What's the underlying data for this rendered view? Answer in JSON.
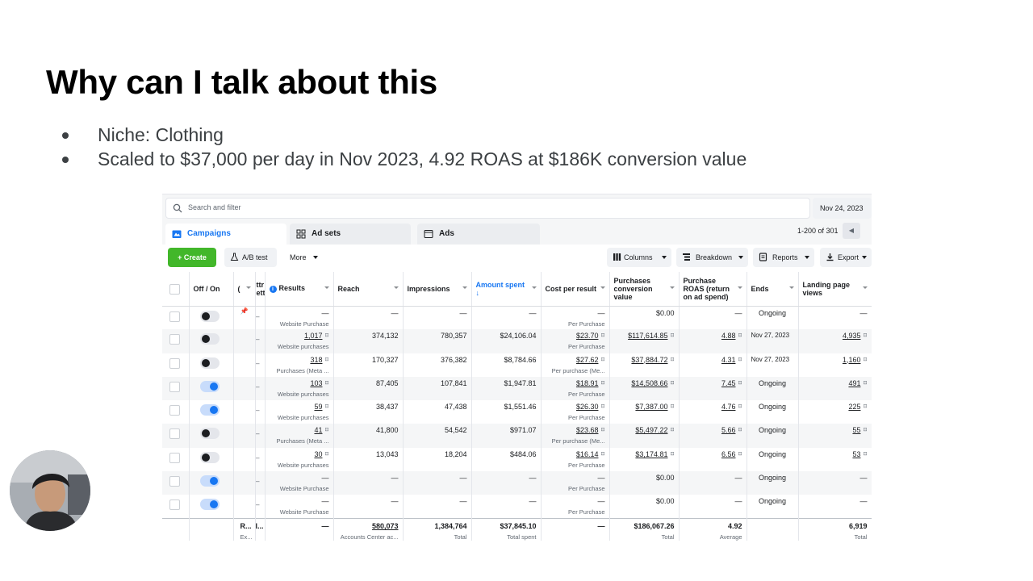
{
  "slide": {
    "title": "Why can I talk about this",
    "bullets": [
      "Niche: Clothing",
      "Scaled to $37,000 per day in Nov 2023, 4.92 ROAS at $186K conversion value"
    ]
  },
  "ads_manager": {
    "search_placeholder": "Search and filter",
    "date": "Nov 24, 2023",
    "tabs": [
      "Campaigns",
      "Ad sets",
      "Ads"
    ],
    "pagination": "1-200 of 301",
    "toolbar": {
      "create": "Create",
      "ab_test": "A/B test",
      "more": "More",
      "columns": "Columns",
      "breakdown": "Breakdown",
      "reports": "Reports",
      "export": "Export"
    },
    "headers": {
      "off_on": "Off / On",
      "c": "(",
      "attr": "ttr ett",
      "results": "Results",
      "reach": "Reach",
      "impressions": "Impressions",
      "amount_spent": "Amount spent",
      "cost_per_result": "Cost per result",
      "purchases_value": "Purchases conversion value",
      "roas": "Purchase ROAS (return on ad spend)",
      "ends": "Ends",
      "lpv": "Landing page views"
    },
    "rows": [
      {
        "on": false,
        "results": "—",
        "results_sub": "Website Purchase",
        "reach": "—",
        "impressions": "—",
        "spent": "—",
        "cpr": "—",
        "cpr_sub": "Per Purchase",
        "value": "$0.00",
        "roas": "—",
        "ends": "Ongoing",
        "lpv": "—"
      },
      {
        "on": false,
        "results": "1,017",
        "results_sub": "Website purchases",
        "reach": "374,132",
        "impressions": "780,357",
        "spent": "$24,106.04",
        "cpr": "$23.70",
        "cpr_sub": "Per Purchase",
        "value": "$117,614.85",
        "roas": "4.88",
        "ends": "Nov 27, 2023",
        "lpv": "4,935"
      },
      {
        "on": false,
        "results": "318",
        "results_sub": "Purchases (Meta ...",
        "reach": "170,327",
        "impressions": "376,382",
        "spent": "$8,784.66",
        "cpr": "$27.62",
        "cpr_sub": "Per purchase (Me...",
        "value": "$37,884.72",
        "roas": "4.31",
        "ends": "Nov 27, 2023",
        "lpv": "1,160"
      },
      {
        "on": true,
        "results": "103",
        "results_sub": "Website purchases",
        "reach": "87,405",
        "impressions": "107,841",
        "spent": "$1,947.81",
        "cpr": "$18.91",
        "cpr_sub": "Per Purchase",
        "value": "$14,508.66",
        "roas": "7.45",
        "ends": "Ongoing",
        "lpv": "491"
      },
      {
        "on": true,
        "results": "59",
        "results_sub": "Website purchases",
        "reach": "38,437",
        "impressions": "47,438",
        "spent": "$1,551.46",
        "cpr": "$26.30",
        "cpr_sub": "Per Purchase",
        "value": "$7,387.00",
        "roas": "4.76",
        "ends": "Ongoing",
        "lpv": "225"
      },
      {
        "on": false,
        "results": "41",
        "results_sub": "Purchases (Meta ...",
        "reach": "41,800",
        "impressions": "54,542",
        "spent": "$971.07",
        "cpr": "$23.68",
        "cpr_sub": "Per purchase (Me...",
        "value": "$5,497.22",
        "roas": "5.66",
        "ends": "Ongoing",
        "lpv": "55"
      },
      {
        "on": false,
        "results": "30",
        "results_sub": "Website purchases",
        "reach": "13,043",
        "impressions": "18,204",
        "spent": "$484.06",
        "cpr": "$16.14",
        "cpr_sub": "Per Purchase",
        "value": "$3,174.81",
        "roas": "6.56",
        "ends": "Ongoing",
        "lpv": "53"
      },
      {
        "on": true,
        "results": "—",
        "results_sub": "Website Purchase",
        "reach": "—",
        "impressions": "—",
        "spent": "—",
        "cpr": "—",
        "cpr_sub": "Per Purchase",
        "value": "$0.00",
        "roas": "—",
        "ends": "Ongoing",
        "lpv": "—"
      },
      {
        "on": true,
        "results": "—",
        "results_sub": "Website Purchase",
        "reach": "—",
        "impressions": "—",
        "spent": "—",
        "cpr": "—",
        "cpr_sub": "Per Purchase",
        "value": "$0.00",
        "roas": "—",
        "ends": "Ongoing",
        "lpv": "—"
      }
    ],
    "totals": {
      "name": "R...",
      "name_sub": "Ex...",
      "attr": "I...",
      "results": "—",
      "reach": "580,073",
      "reach_sub": "Accounts Center ac...",
      "impressions": "1,384,764",
      "impressions_sub": "Total",
      "spent": "$37,845.10",
      "spent_sub": "Total spent",
      "cpr": "—",
      "value": "$186,067.26",
      "value_sub": "Total",
      "roas": "4.92",
      "roas_sub": "Average",
      "lpv": "6,919",
      "lpv_sub": "Total"
    }
  },
  "colors": {
    "accent_blue": "#1877f2",
    "create_green": "#42b72a"
  }
}
